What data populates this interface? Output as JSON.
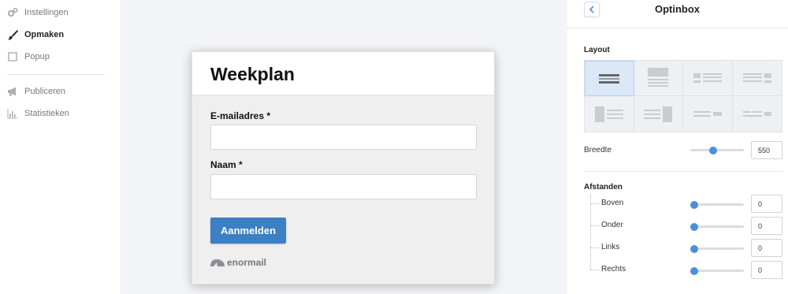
{
  "sidebar": {
    "items": [
      {
        "label": "Instellingen",
        "icon": "gears-icon",
        "active": false
      },
      {
        "label": "Opmaken",
        "icon": "brush-icon",
        "active": true
      },
      {
        "label": "Popup",
        "icon": "square-icon",
        "active": false
      },
      {
        "label": "Publiceren",
        "icon": "megaphone-icon",
        "active": false
      },
      {
        "label": "Statistieken",
        "icon": "bar-chart-icon",
        "active": false
      }
    ]
  },
  "preview": {
    "title": "Weekplan",
    "email_label": "E-mailadres *",
    "email_value": "",
    "name_label": "Naam *",
    "name_value": "",
    "submit_label": "Aanmelden",
    "brand": "enormail",
    "button_color": "#3b7fc4"
  },
  "panel": {
    "title": "Optinbox",
    "back_icon": "chevron-left-icon",
    "layout": {
      "section_title": "Layout",
      "selected_index": 0,
      "width_label": "Breedte",
      "width_value": "550",
      "width_slider_fraction": 0.41
    },
    "spacing": {
      "section_title": "Afstanden",
      "rows": [
        {
          "label": "Boven",
          "value": "0",
          "slider_fraction": 0
        },
        {
          "label": "Onder",
          "value": "0",
          "slider_fraction": 0
        },
        {
          "label": "Links",
          "value": "0",
          "slider_fraction": 0
        },
        {
          "label": "Rechts",
          "value": "0",
          "slider_fraction": 0
        }
      ]
    },
    "accent_color": "#4a90d9"
  }
}
